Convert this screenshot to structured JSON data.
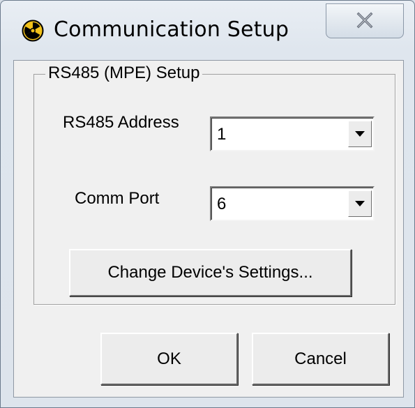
{
  "window": {
    "title": "Communication Setup",
    "icon": "radiation-trefoil-icon",
    "close_icon": "close-x-icon"
  },
  "group": {
    "legend": "RS485 (MPE) Setup",
    "address_label": "RS485 Address",
    "address_value": "1",
    "comm_port_label": "Comm Port",
    "comm_port_value": "6",
    "change_settings_label": "Change Device's Settings..."
  },
  "buttons": {
    "ok_label": "OK",
    "cancel_label": "Cancel"
  },
  "colors": {
    "dialog_face": "#f0f0f0",
    "frame": "#dfe6ee",
    "icon_yellow": "#f2c21b"
  }
}
